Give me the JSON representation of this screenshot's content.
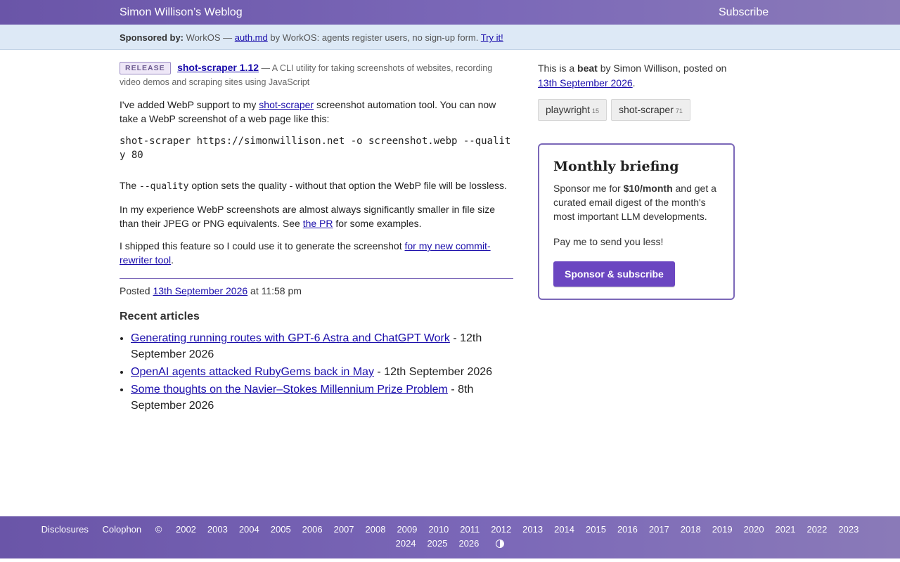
{
  "header": {
    "site_title": "Simon Willison’s Weblog",
    "subscribe_label": "Subscribe"
  },
  "sponsor": {
    "label": "Sponsored by:",
    "company": "WorkOS —",
    "link": "auth.md",
    "text": "by WorkOS: agents register users, no sign-up form.",
    "cta": "Try it!"
  },
  "release": {
    "badge": "RELEASE",
    "title": "shot-scraper 1.12",
    "description": "— A CLI utility for taking screenshots of websites, recording video demos and scraping sites using JavaScript"
  },
  "post": {
    "p1_pre": "I've added WebP support to my",
    "p1_link": "shot-scraper",
    "p1_post": "screenshot automation tool. You can now take a WebP screenshot of a web page like this:",
    "code": "shot-scraper https://simonwillison.net -o screenshot.webp --quality 80",
    "p2_pre": "The",
    "p2_code": "--quality",
    "p2_post": "option sets the quality - without that option the WebP file will be lossless.",
    "p3_pre": "In my experience WebP screenshots are almost always significantly smaller in file size than their JPEG or PNG equivalents. See",
    "p3_link": "the PR",
    "p3_post": "for some examples.",
    "p4_pre": "I shipped this feature so I could use it to generate the screenshot",
    "p4_link": "for my new commit-rewriter tool",
    "p4_post": ".",
    "posted_label": "Posted",
    "posted_date": "13th September 2026",
    "posted_time": "at 11:58 pm"
  },
  "recent": {
    "heading": "Recent articles",
    "items": [
      {
        "title": "Generating running routes with GPT-6 Astra and ChatGPT Work",
        "date": "- 12th September 2026"
      },
      {
        "title": "OpenAI agents attacked RubyGems back in May",
        "date": "- 12th September 2026"
      },
      {
        "title": "Some thoughts on the Navier–Stokes Millennium Prize Problem",
        "date": "- 8th September 2026"
      }
    ]
  },
  "sidebar": {
    "intro_pre": "This is a",
    "intro_bold": "beat",
    "intro_post": "by Simon Willison, posted on",
    "date_link": "13th September 2026",
    "date_suffix": ".",
    "tags": [
      {
        "name": "playwright",
        "count": "15"
      },
      {
        "name": "shot-scraper",
        "count": "71"
      }
    ]
  },
  "briefing": {
    "title": "Monthly briefing",
    "text_pre": "Sponsor me for",
    "text_bold": "$10/month",
    "text_post": "and get a curated email digest of the month's most important LLM developments.",
    "text2": "Pay me to send you less!",
    "button": "Sponsor & subscribe"
  },
  "footer": {
    "disclosures": "Disclosures",
    "colophon": "Colophon",
    "copyright": "©",
    "years_row1": [
      "2002",
      "2003",
      "2004",
      "2005",
      "2006",
      "2007",
      "2008",
      "2009",
      "2010",
      "2011",
      "2012",
      "2013",
      "2014",
      "2015",
      "2016",
      "2017",
      "2018",
      "2019",
      "2020",
      "2021",
      "2022",
      "2023"
    ],
    "years_row2": [
      "2024",
      "2025",
      "2026"
    ]
  },
  "colors": {
    "accent": "#7b68b8",
    "link": "#1a0dab",
    "button": "#6b46c1",
    "sponsor_bar": "#dde9f6"
  },
  "icons": {
    "theme_toggle": "contrast-icon"
  }
}
